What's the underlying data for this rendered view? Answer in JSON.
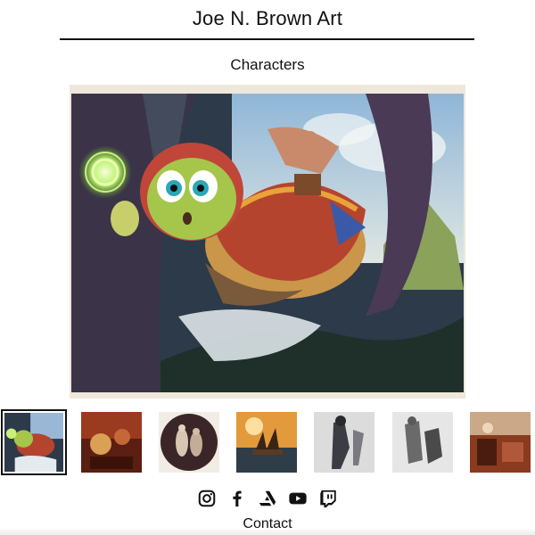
{
  "header": {
    "site_title": "Joe N. Brown Art"
  },
  "gallery": {
    "section_title": "Characters",
    "main_image": {
      "subject": "turtle-creature-with-rider",
      "selected_index": 0
    },
    "thumbnails": [
      {
        "subject": "turtle-creature-with-rider",
        "selected": true
      },
      {
        "subject": "red-warrior-scene",
        "selected": false
      },
      {
        "subject": "figures-in-dark-circle",
        "selected": false
      },
      {
        "subject": "ship-at-sunset",
        "selected": false
      },
      {
        "subject": "grey-sketch-figure",
        "selected": false
      },
      {
        "subject": "monochrome-sketch-figures",
        "selected": false
      },
      {
        "subject": "red-interior-scene",
        "selected": false
      }
    ]
  },
  "social": [
    {
      "icon": "instagram-icon"
    },
    {
      "icon": "facebook-icon"
    },
    {
      "icon": "artstation-icon"
    },
    {
      "icon": "youtube-icon"
    },
    {
      "icon": "twitch-icon"
    }
  ],
  "footer": {
    "contact_label": "Contact"
  }
}
